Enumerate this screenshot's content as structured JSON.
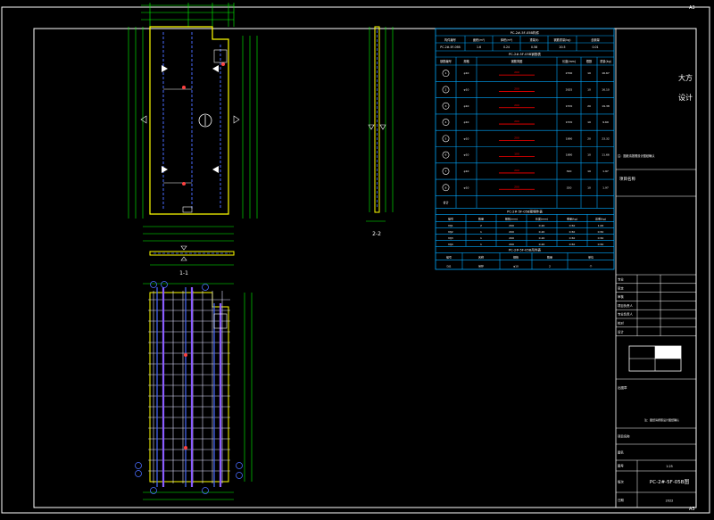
{
  "corner_labels": {
    "top_right": "A3",
    "bottom_right": "A3"
  },
  "views": {
    "plan_caption": "1-1",
    "section_caption": "2-2"
  },
  "table_main": {
    "title": "PC-2#-5F-05B构件",
    "headers": [
      "构件编号",
      "面积(m²)",
      "体积(m³)",
      "重量(t)",
      "钢筋重量(kg)",
      "含钢量"
    ],
    "row": [
      "PC-2#-5F-05B",
      "1.6",
      "0.24",
      "0.58",
      "20.5",
      "0.01"
    ]
  },
  "table_rebar": {
    "title": "PC-2#-5F-05B钢筋表",
    "headers": [
      "钢筋编号",
      "规格",
      "钢筋简图",
      "长度(mm)",
      "根数",
      "重量(kg)"
    ],
    "rows": [
      [
        "1",
        "φ10",
        "200",
        "2700",
        "10",
        "16.67"
      ],
      [
        "2",
        "φ10",
        "200",
        "2625",
        "10",
        "16.10"
      ],
      [
        "3",
        "φ10",
        "200",
        "1570",
        "20",
        "19.38"
      ],
      [
        "4",
        "φ10",
        "200",
        "1570",
        "10",
        "9.69"
      ],
      [
        "5",
        "φ10",
        "200",
        "1890",
        "20",
        "23.32"
      ],
      [
        "6",
        "φ10",
        "100",
        "1890",
        "10",
        "11.66"
      ],
      [
        "7",
        "φ10",
        "200",
        "320",
        "10",
        "1.97"
      ],
      [
        "8",
        "φ10",
        "200",
        "320",
        "10",
        "1.97"
      ]
    ],
    "total_label": "合计"
  },
  "table_embed": {
    "title": "PC-2#-5F-05B预埋件表",
    "headers": [
      "编号",
      "数量",
      "规格(mm)",
      "长度(mm)",
      "重量(kg)",
      "总重(kg)"
    ],
    "rows": [
      [
        "MJ1",
        "2",
        "200",
        "0.20",
        "0.50",
        "1.00"
      ],
      [
        "MJ2",
        "1",
        "200",
        "0.20",
        "0.50",
        "0.50"
      ],
      [
        "MJ3",
        "1",
        "200",
        "0.20",
        "0.50",
        "0.50"
      ],
      [
        "MJ4",
        "1",
        "200",
        "0.20",
        "0.50",
        "0.50"
      ]
    ]
  },
  "table_lift": {
    "title": "PC-2#-5F-05B吊件表",
    "headers": [
      "编号",
      "名称",
      "规格",
      "数量",
      "单位"
    ],
    "row": [
      "DJ1",
      "吊环",
      "φ10",
      "2",
      "个"
    ]
  },
  "title_block": {
    "logo_text": "大方",
    "logo_text2": "设计",
    "note_small": "注：图纸请按照设计图纸确认",
    "project_label": "项目名称",
    "stamp_rows": [
      "专业",
      "审定",
      "审核",
      "项目负责人",
      "专业负责人",
      "校对",
      "设计"
    ],
    "drawing_name_label": "图名",
    "drawing_no_label": "图号",
    "drawing_no": "PC-2#-5F-05B图",
    "scale_label": "比例",
    "scale": "1:25",
    "date_label": "日期",
    "date": "2022",
    "sheet_label": "版次",
    "org_label": "出图章"
  },
  "colors": {
    "frame": "#ffffff",
    "panel_outline": "#ffff00",
    "dimension": "#00ff00",
    "table_line": "#00a8ff",
    "table_text": "#ffffff",
    "rebar_shape": "#ff0000",
    "rebar_blue": "#4a6cff",
    "rebar_purple": "#8a5cff",
    "grid_white": "#e0e0ff"
  }
}
